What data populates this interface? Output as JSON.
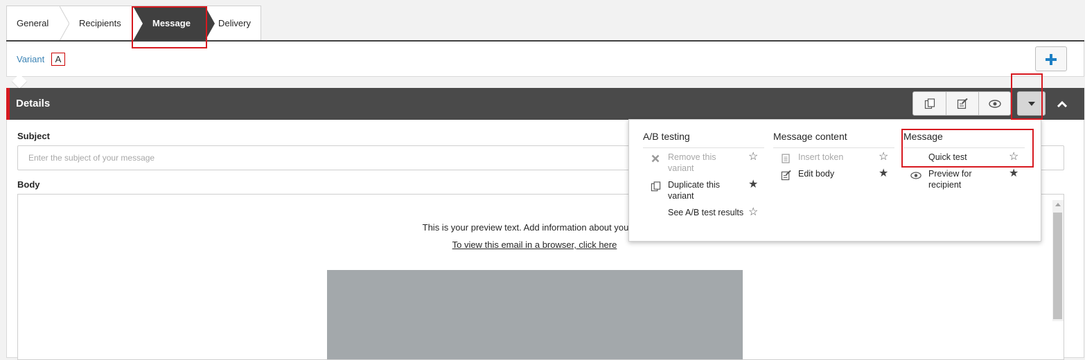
{
  "tabs": [
    {
      "label": "General"
    },
    {
      "label": "Recipients"
    },
    {
      "label": "Message",
      "active": true
    },
    {
      "label": "Delivery"
    }
  ],
  "variant": {
    "link_label": "Variant",
    "badge": "A"
  },
  "add_button_icon": "plus-icon",
  "details": {
    "title": "Details",
    "toolbar_icons": [
      "duplicate-icon",
      "edit-body-icon",
      "preview-eye-icon"
    ],
    "more_icon": "caret-down-icon",
    "collapse_icon": "caret-up-icon"
  },
  "form": {
    "subject_label": "Subject",
    "subject_placeholder": "Enter the subject of your message",
    "subject_value": "",
    "body_label": "Body"
  },
  "email_preview": {
    "preview_text": "This is your preview text. Add information about your em",
    "browser_link": "To view this email in a browser, click here"
  },
  "menu": {
    "columns": [
      {
        "heading": "A/B testing",
        "items": [
          {
            "label": "Remove this variant",
            "icon": "close-x-icon",
            "disabled": true,
            "favorite": false
          },
          {
            "label": "Duplicate this variant",
            "icon": "duplicate-icon",
            "disabled": false,
            "favorite": true
          },
          {
            "label": "See A/B test results",
            "icon": "",
            "disabled": false,
            "favorite": false
          }
        ]
      },
      {
        "heading": "Message content",
        "items": [
          {
            "label": "Insert token",
            "icon": "token-icon",
            "disabled": true,
            "favorite": false
          },
          {
            "label": "Edit body",
            "icon": "edit-body-icon",
            "disabled": false,
            "favorite": true
          }
        ]
      },
      {
        "heading": "Message",
        "items": [
          {
            "label": "Quick test",
            "icon": "",
            "disabled": false,
            "favorite": false
          },
          {
            "label": "Preview for recipient",
            "icon": "preview-eye-icon",
            "disabled": false,
            "favorite": true
          }
        ]
      }
    ]
  },
  "colors": {
    "accent_red": "#d71920",
    "header_dark": "#4a4a4a",
    "link_blue": "#3b83b5",
    "add_blue": "#1d7fc4"
  }
}
